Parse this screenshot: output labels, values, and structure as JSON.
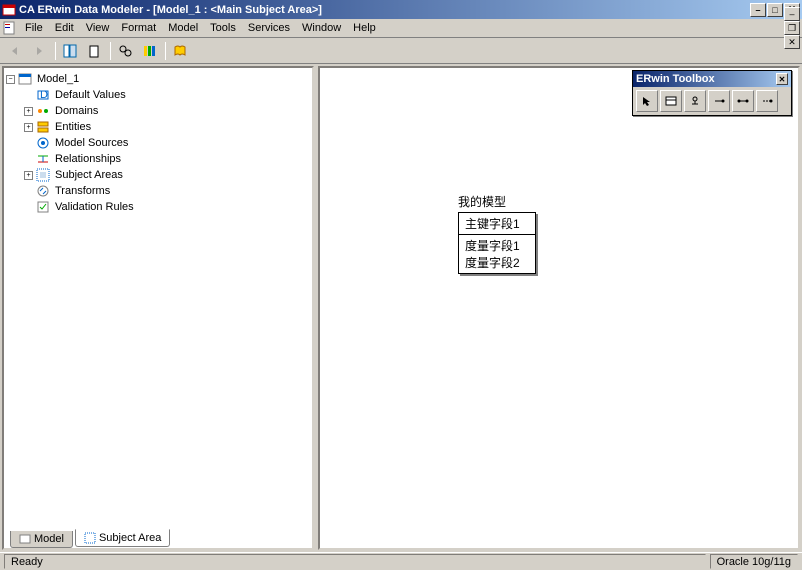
{
  "title": "CA ERwin Data Modeler - [Model_1 : <Main Subject Area>]",
  "menu": {
    "file": "File",
    "edit": "Edit",
    "view": "View",
    "format": "Format",
    "model": "Model",
    "tools": "Tools",
    "services": "Services",
    "window": "Window",
    "help": "Help"
  },
  "toolbox": {
    "title": "ERwin Toolbox"
  },
  "tree": {
    "root": "Model_1",
    "items": [
      "Default Values",
      "Domains",
      "Entities",
      "Model Sources",
      "Relationships",
      "Subject Areas",
      "Transforms",
      "Validation Rules"
    ]
  },
  "tabs": {
    "model": "Model",
    "subjectarea": "Subject Area"
  },
  "entity": {
    "name": "我的模型",
    "pk": "主键字段1",
    "attrs": [
      "度量字段1",
      "度量字段2"
    ]
  },
  "status": {
    "ready": "Ready",
    "db": "Oracle 10g/11g"
  }
}
